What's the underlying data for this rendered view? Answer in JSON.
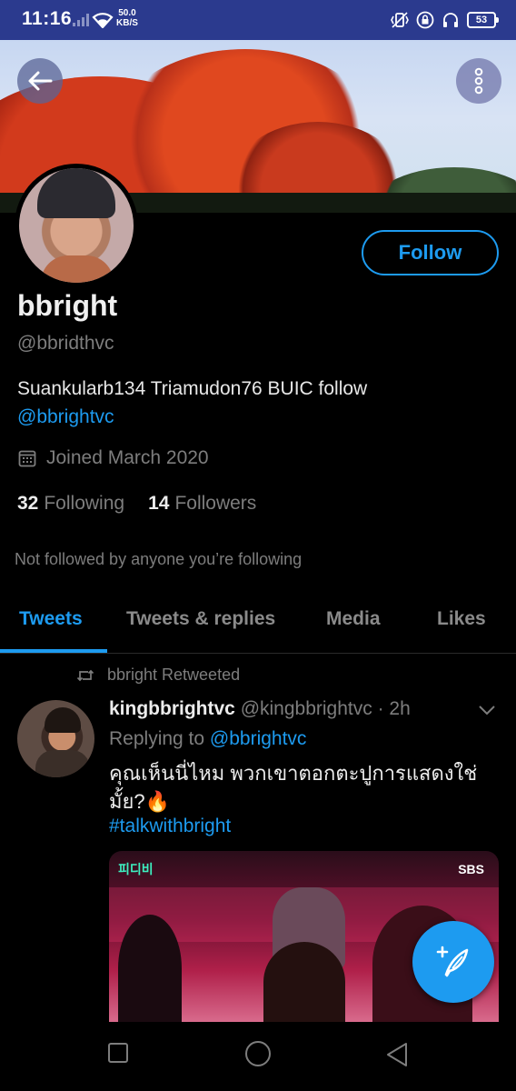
{
  "status_bar": {
    "time": "11:16",
    "speed_value": "50.0",
    "speed_unit": "KB/S",
    "battery": "53"
  },
  "header": {
    "back_icon": "arrow-left-icon",
    "more_icon": "more-vertical-icon"
  },
  "profile": {
    "name": "bbright",
    "handle": "@bbridthvc",
    "bio_text": "Suankularb134 Triamudon76 BUIC follow",
    "bio_link": "@bbrightvc",
    "joined": "Joined March 2020",
    "following_count": "32",
    "following_label": "Following",
    "followers_count": "14",
    "followers_label": "Followers",
    "not_followed": "Not followed by anyone you’re following",
    "follow_button": "Follow"
  },
  "tabs": [
    {
      "label": "Tweets",
      "active": true
    },
    {
      "label": "Tweets & replies",
      "active": false
    },
    {
      "label": "Media",
      "active": false
    },
    {
      "label": "Likes",
      "active": false
    }
  ],
  "tweet": {
    "retweet_label": "bbright Retweeted",
    "author_name": "kingbbrightvc",
    "author_handle": "@kingbbrightvc",
    "time": "· 2h",
    "replying_prefix": "Replying to",
    "replying_to": "@bbrightvc",
    "text": "คุณเห็นนี่ไหม พวกเขาตอกตะปูการแสดงใช่มั้ย?🔥",
    "hashtag": "#talkwithbright",
    "media_channel": "SBS",
    "media_logo": "피디비"
  },
  "colors": {
    "accent": "#1d9bf0",
    "status_bar": "#2b3a8e",
    "background": "#000000"
  }
}
